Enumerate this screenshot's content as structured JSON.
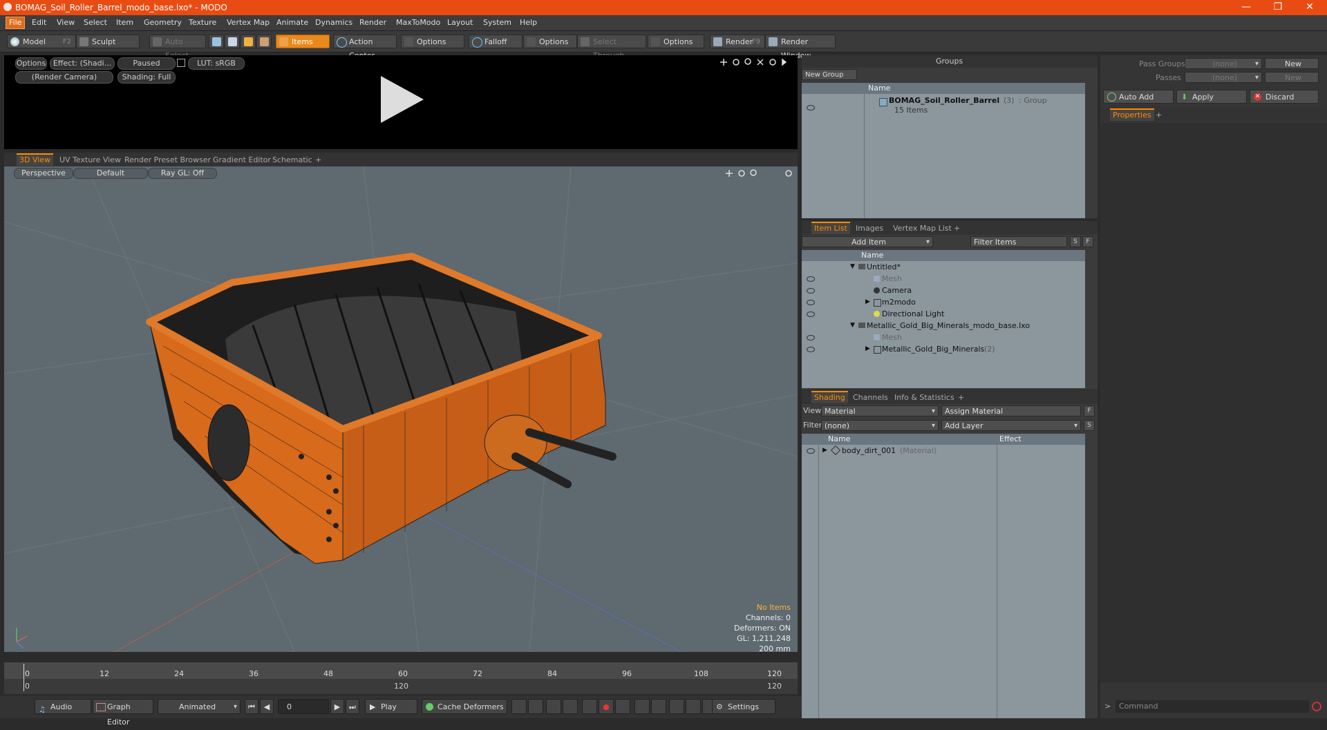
{
  "window": {
    "title": "BOMAG_Soil_Roller_Barrel_modo_base.lxo* - MODO",
    "minimize": "—",
    "maximize": "❐",
    "close": "✕"
  },
  "menu": [
    "File",
    "Edit",
    "View",
    "Select",
    "Item",
    "Geometry",
    "Texture",
    "Vertex Map",
    "Animate",
    "Dynamics",
    "Render",
    "MaxToModo",
    "Layout",
    "System",
    "Help"
  ],
  "toolbar": {
    "model": "Model",
    "model_key": "F2",
    "sculpt": "Sculpt",
    "auto_select": "Auto Select",
    "items": "Items",
    "action_center": "Action Center",
    "options1": "Options",
    "falloff": "Falloff",
    "options2": "Options",
    "select_through": "Select Through",
    "options3": "Options",
    "render": "Render",
    "render_key": "F9",
    "render_window": "Render Window"
  },
  "preview": {
    "options": "Options",
    "effect": "Effect: (Shadi...",
    "paused": "Paused",
    "lut": "LUT: sRGB",
    "camera": "(Render Camera)",
    "shading": "Shading: Full"
  },
  "viewport_tabs": [
    "3D View",
    "UV Texture View",
    "Render Preset Browser",
    "Gradient Editor",
    "Schematic"
  ],
  "viewport": {
    "perspective": "Perspective",
    "default": "Default",
    "raygl": "Ray GL: Off",
    "stats": {
      "no_items": "No Items",
      "channels": "Channels: 0",
      "deformers": "Deformers: ON",
      "gl": "GL: 1,211,248",
      "scale": "200 mm"
    }
  },
  "timeline": {
    "ticks": [
      "0",
      "12",
      "24",
      "36",
      "48",
      "60",
      "72",
      "84",
      "96",
      "108",
      "120"
    ],
    "start": "0",
    "end": "120",
    "current": "120"
  },
  "bottom": {
    "audio": "Audio",
    "graph_editor": "Graph Editor",
    "animated": "Animated",
    "frame": "0",
    "play": "Play",
    "cache_deformers": "Cache Deformers",
    "settings": "Settings"
  },
  "groups": {
    "title": "Groups",
    "new_group": "New Group",
    "col_name": "Name",
    "item_name": "BOMAG_Soil_Roller_Barrel",
    "item_count": "(3)",
    "item_type": ": Group",
    "item_sub": "15 Items"
  },
  "item_list": {
    "tabs": [
      "Item List",
      "Images",
      "Vertex Map List"
    ],
    "add_item": "Add Item",
    "filter": "Filter Items",
    "s": "S",
    "f": "F",
    "col_name": "Name",
    "rows": [
      {
        "label": "Untitled*"
      },
      {
        "label": "Mesh"
      },
      {
        "label": "Camera"
      },
      {
        "label": "m2modo"
      },
      {
        "label": "Directional Light"
      },
      {
        "label": "Metallic_Gold_Big_Minerals_modo_base.lxo"
      },
      {
        "label": "Mesh"
      },
      {
        "label": "Metallic_Gold_Big_Minerals",
        "suffix": "(2)"
      }
    ]
  },
  "shading": {
    "tabs": [
      "Shading",
      "Channels",
      "Info & Statistics"
    ],
    "view_label": "View",
    "view_value": "Material",
    "assign": "Assign Material",
    "f": "F",
    "filter_label": "Filter",
    "filter_value": "(none)",
    "add_layer": "Add Layer",
    "s": "S",
    "col_name": "Name",
    "col_effect": "Effect",
    "row_name": "body_dirt_001",
    "row_type": "(Material)"
  },
  "pass": {
    "pass_groups": "Pass Groups",
    "passes": "Passes",
    "none1": "(none)",
    "none2": "(none)",
    "new1": "New",
    "new2": "New",
    "auto_add": "Auto Add",
    "apply": "Apply",
    "discard": "Discard",
    "properties": "Properties",
    "command": "Command"
  }
}
